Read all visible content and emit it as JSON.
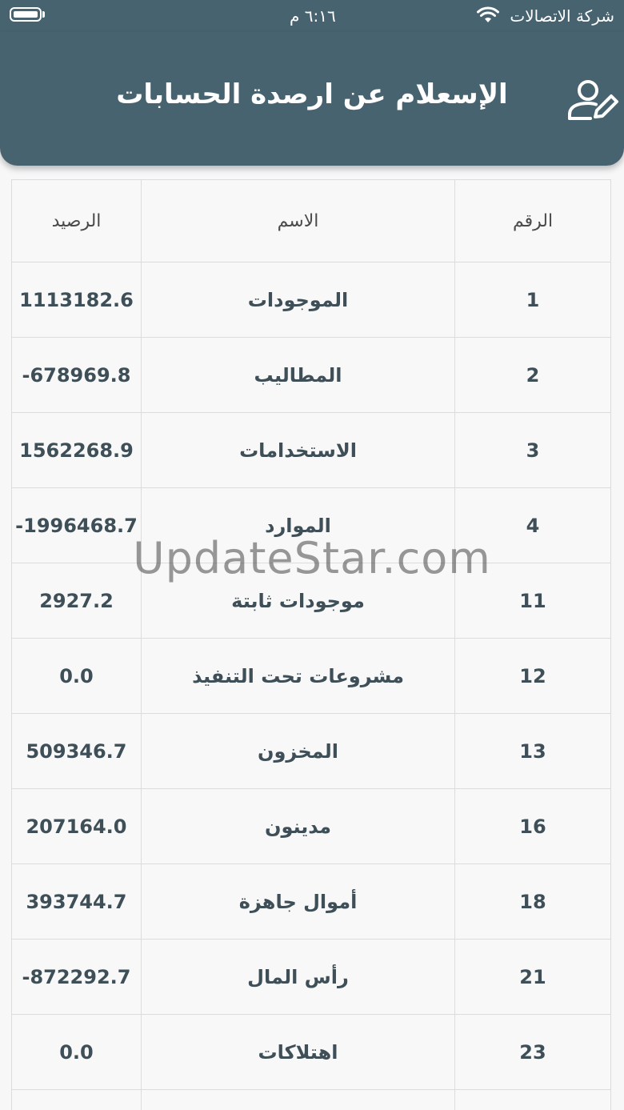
{
  "status_bar": {
    "carrier": "شركة الاتصالات",
    "time": "٦:١٦ م"
  },
  "app_bar": {
    "title": "الإسعلام عن ارصدة الحسابات",
    "icon": "user-edit-icon"
  },
  "table": {
    "headers": {
      "number": "الرقم",
      "name": "الاسم",
      "balance": "الرصيد"
    },
    "rows": [
      {
        "number": "1",
        "name": "الموجودات",
        "balance": "1113182.6"
      },
      {
        "number": "2",
        "name": "المطاليب",
        "balance": "-678969.8"
      },
      {
        "number": "3",
        "name": "الاستخدامات",
        "balance": "1562268.9"
      },
      {
        "number": "4",
        "name": "الموارد",
        "balance": "-1996468.7"
      },
      {
        "number": "11",
        "name": "موجودات ثابتة",
        "balance": "2927.2"
      },
      {
        "number": "12",
        "name": "مشروعات تحت التنفيذ",
        "balance": "0.0"
      },
      {
        "number": "13",
        "name": "المخزون",
        "balance": "509346.7"
      },
      {
        "number": "16",
        "name": "مدينون",
        "balance": "207164.0"
      },
      {
        "number": "18",
        "name": "أموال جاهزة",
        "balance": "393744.7"
      },
      {
        "number": "21",
        "name": "رأس المال",
        "balance": "-872292.7"
      },
      {
        "number": "23",
        "name": "اهتلاكات",
        "balance": "0.0"
      },
      {
        "number": "",
        "name": "",
        "balance": ""
      }
    ]
  },
  "watermark": "UpdateStar.com",
  "colors": {
    "primary": "#486370",
    "text": "#3f4f58"
  }
}
